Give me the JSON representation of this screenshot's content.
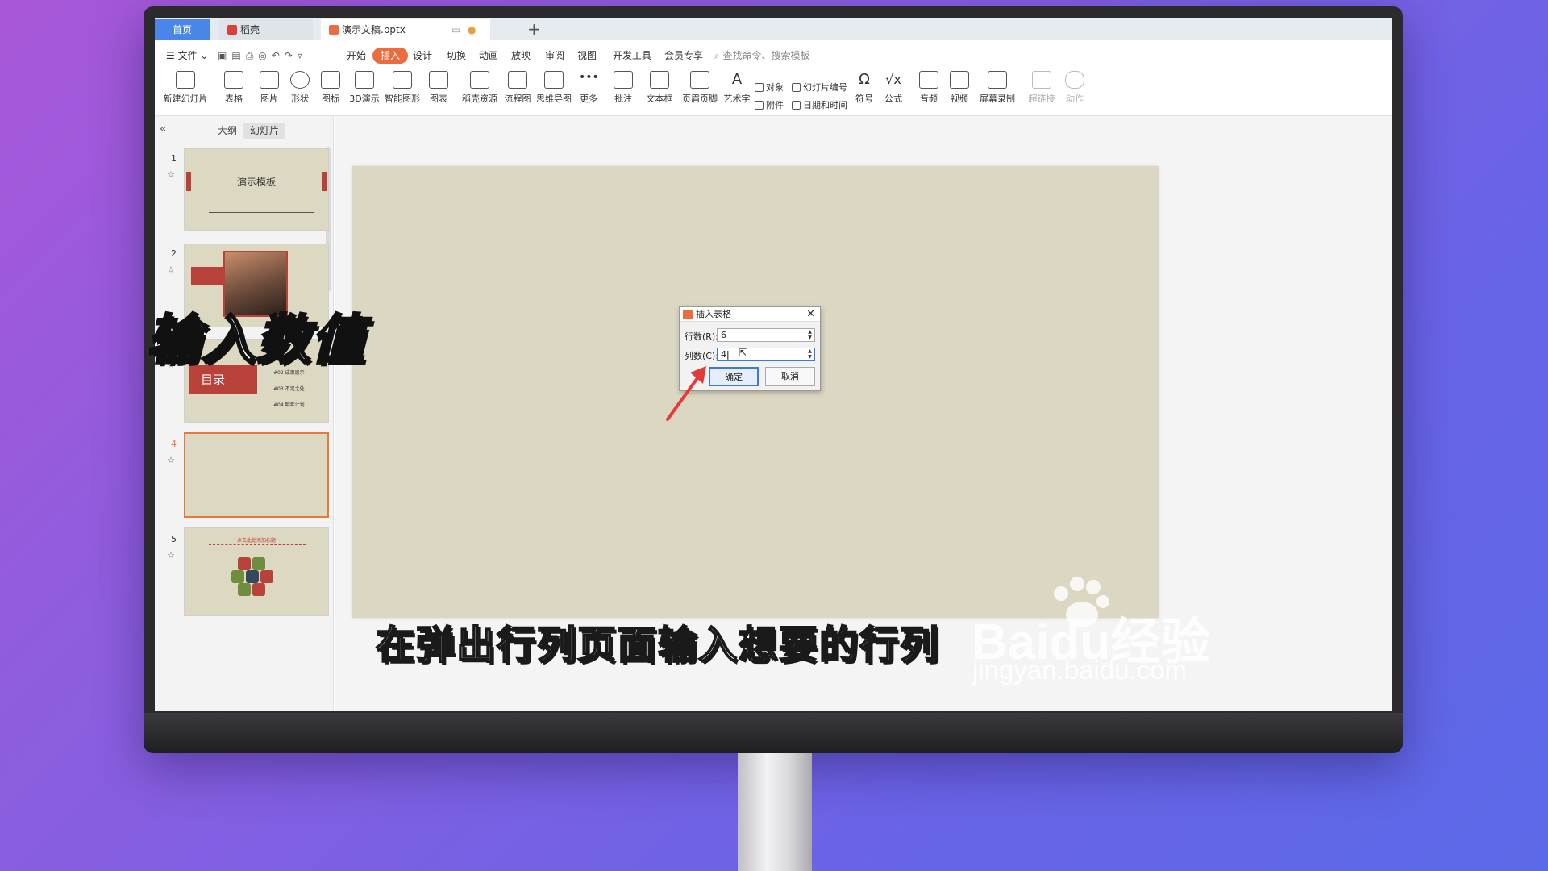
{
  "tabs": {
    "home": "首页",
    "daoke": "稻壳",
    "doc": "演示文稿.pptx"
  },
  "menu": {
    "file": "文件",
    "items": [
      "开始",
      "插入",
      "设计",
      "切换",
      "动画",
      "放映",
      "审阅",
      "视图",
      "开发工具",
      "会员专享"
    ],
    "active": "插入",
    "search": "查找命令、搜索模板"
  },
  "ribbon": {
    "new_slide": "新建幻灯片",
    "table": "表格",
    "picture": "图片",
    "shape": "形状",
    "icon": "图标",
    "d3": "3D演示",
    "smart": "智能图形",
    "chart": "图表",
    "resource": "稻壳资源",
    "flow": "流程图",
    "mind": "思维导图",
    "more": "更多",
    "comment": "批注",
    "textbox": "文本框",
    "header_footer": "页眉页脚",
    "wordart": "艺术字",
    "object": "对象",
    "attach": "附件",
    "slide_no": "幻灯片编号",
    "datetime": "日期和时间",
    "symbol": "符号",
    "formula": "公式",
    "audio": "音频",
    "video": "视频",
    "screen_rec": "屏幕录制",
    "hyperlink": "超链接",
    "action": "动作"
  },
  "panel": {
    "outline": "大纲",
    "slides": "幻灯片",
    "collapse": "«"
  },
  "slides": [
    {
      "num": "1",
      "title": "演示模板"
    },
    {
      "num": "2"
    },
    {
      "num": "3",
      "title": "目录",
      "items": [
        "#02 成果展示",
        "#03 不足之处",
        "#04 明年计划"
      ]
    },
    {
      "num": "4"
    },
    {
      "num": "5",
      "title": "点击此处添加标题"
    }
  ],
  "dialog": {
    "title": "插入表格",
    "rows_label": "行数(R):",
    "rows_value": "6",
    "cols_label": "列数(C):",
    "cols_value": "4",
    "ok": "确定",
    "cancel": "取消"
  },
  "overlay": {
    "step_caption": "输入数值",
    "subtitle": "在弹出行列页面输入想要的行列",
    "watermark_logo": "Baidu经验",
    "watermark_url": "jingyan.baidu.com"
  },
  "colors": {
    "accent": "#ec6b3f",
    "tab_home": "#4a86e8",
    "slide_bg": "#dcd7c2",
    "template_red": "#b8413a"
  }
}
